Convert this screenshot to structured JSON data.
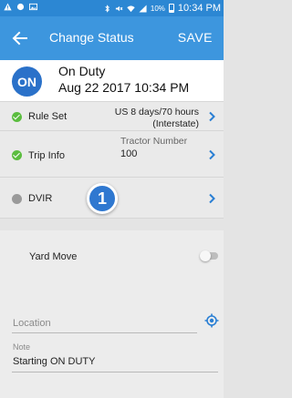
{
  "status_bar": {
    "battery": "10%",
    "time": "10:34 PM"
  },
  "header": {
    "title": "Change Status",
    "save_label": "SAVE"
  },
  "status": {
    "badge": "ON",
    "name": "On Duty",
    "datetime": "Aug 22 2017 10:34 PM"
  },
  "rule_set": {
    "label": "Rule Set",
    "value_line1": "US 8 days/70 hours",
    "value_line2": "(Interstate)"
  },
  "trip_info": {
    "label": "Trip Info",
    "field_label": "Tractor Number",
    "field_value": "100"
  },
  "dvir": {
    "label": "DVIR"
  },
  "marker": {
    "number": "1"
  },
  "yard_move": {
    "label": "Yard Move",
    "enabled": false
  },
  "location": {
    "placeholder": "Location"
  },
  "note": {
    "label": "Note",
    "value": "Starting ON DUTY"
  },
  "colors": {
    "status_bar": "#2c87d3",
    "app_bar": "#3d96de",
    "badge": "#2a71c9",
    "ok_dot": "#5bbd3f",
    "pending_dot": "#9a9a9a",
    "chevron": "#2a7fd4"
  }
}
